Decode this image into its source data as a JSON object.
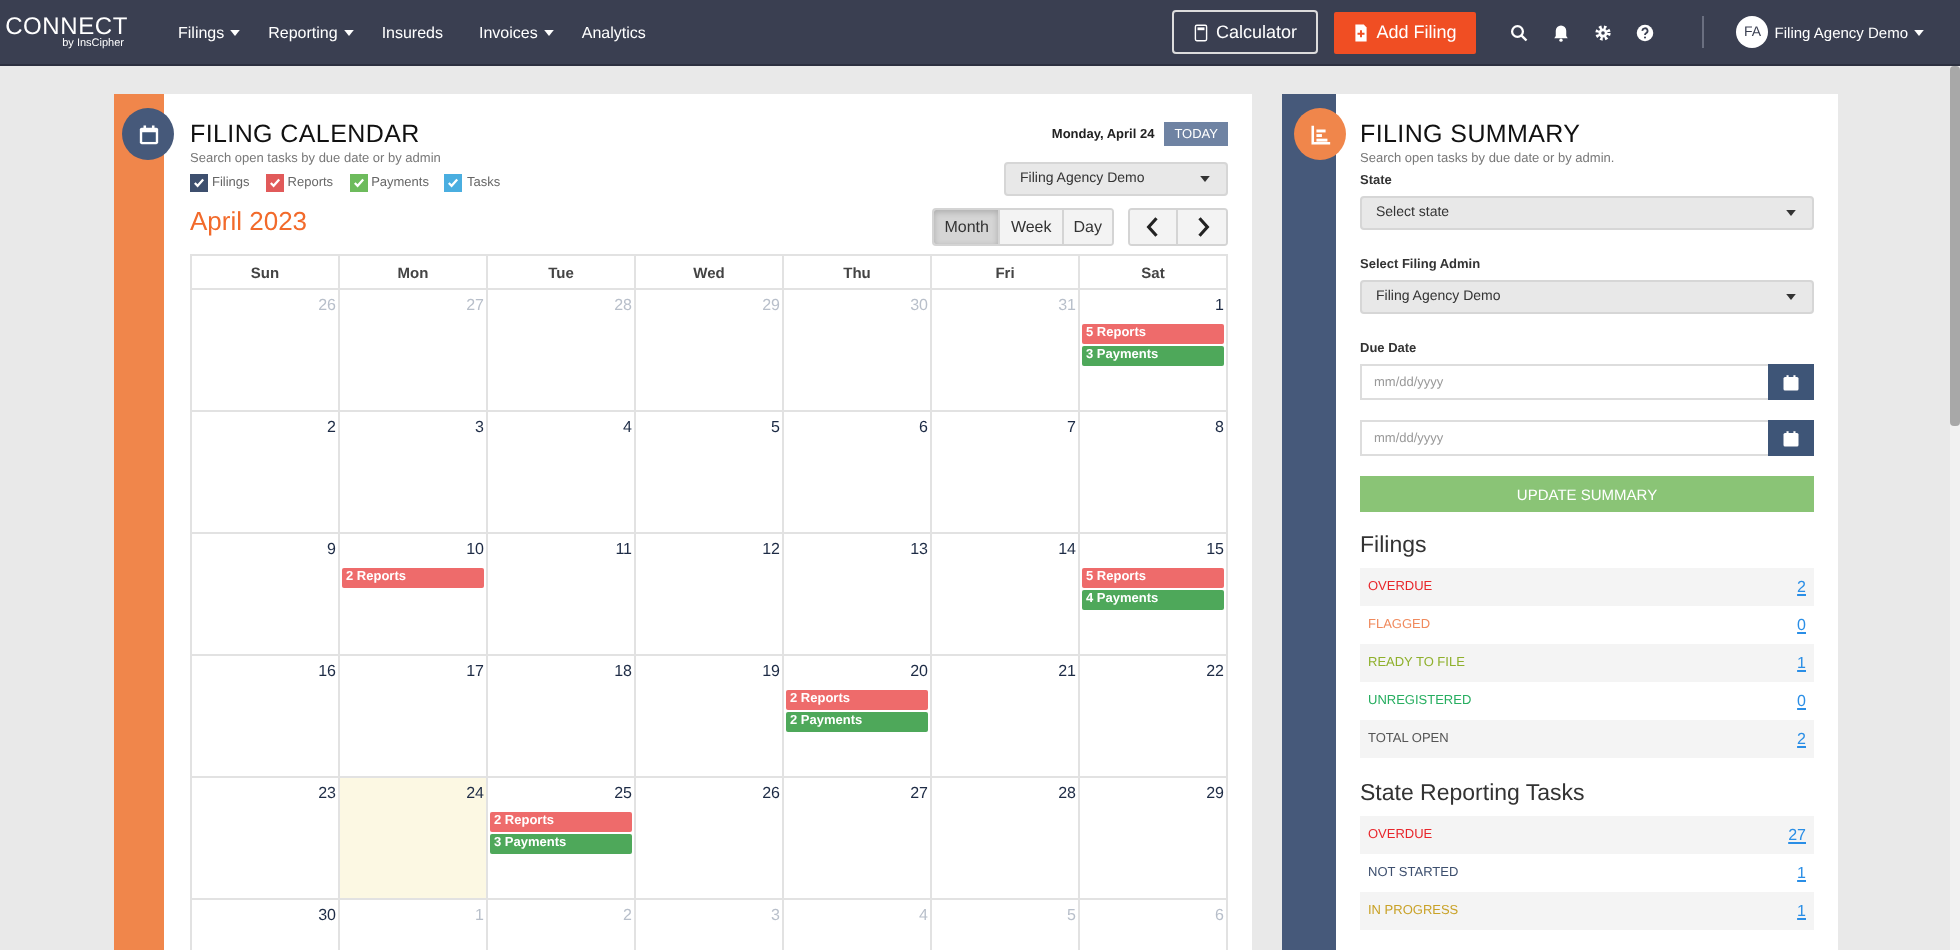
{
  "nav": {
    "logo": "CONNECT",
    "logo_sub": "by InsCipher",
    "menu": [
      {
        "label": "Filings",
        "dropdown": true
      },
      {
        "label": "Reporting",
        "dropdown": true
      },
      {
        "label": "Insureds",
        "dropdown": false
      },
      {
        "label": "Invoices",
        "dropdown": true
      },
      {
        "label": "Analytics",
        "dropdown": false
      }
    ],
    "calculator": "Calculator",
    "add_filing": "Add Filing",
    "user_initials": "FA",
    "user_name": "Filing Agency Demo"
  },
  "calendar": {
    "title": "FILING CALENDAR",
    "subtitle": "Search open tasks by due date or by admin",
    "current_date": "Monday, April 24",
    "today_button": "TODAY",
    "admin_select": "Filing Agency Demo",
    "filters": [
      {
        "label": "Filings",
        "checked": true,
        "color": "#3d4f6e"
      },
      {
        "label": "Reports",
        "checked": true,
        "color": "#e15a5a"
      },
      {
        "label": "Payments",
        "checked": true,
        "color": "#6dbb5c"
      },
      {
        "label": "Tasks",
        "checked": true,
        "color": "#4aaee0"
      }
    ],
    "month_title": "April 2023",
    "views": [
      {
        "label": "Month",
        "selected": true
      },
      {
        "label": "Week",
        "selected": false
      },
      {
        "label": "Day",
        "selected": false
      }
    ],
    "weekdays": [
      "Sun",
      "Mon",
      "Tue",
      "Wed",
      "Thu",
      "Fri",
      "Sat"
    ],
    "weeks": [
      [
        {
          "day": "26",
          "other_month": true,
          "today": false
        },
        {
          "day": "27",
          "other_month": true,
          "today": false
        },
        {
          "day": "28",
          "other_month": true,
          "today": false
        },
        {
          "day": "29",
          "other_month": true,
          "today": false
        },
        {
          "day": "30",
          "other_month": true,
          "today": false
        },
        {
          "day": "31",
          "other_month": true,
          "today": false
        },
        {
          "day": "1",
          "other_month": false,
          "today": false,
          "events": [
            {
              "label": "5 Reports",
              "kind": "report"
            },
            {
              "label": "3 Payments",
              "kind": "payment"
            }
          ]
        }
      ],
      [
        {
          "day": "2",
          "other_month": false,
          "today": false
        },
        {
          "day": "3",
          "other_month": false,
          "today": false
        },
        {
          "day": "4",
          "other_month": false,
          "today": false
        },
        {
          "day": "5",
          "other_month": false,
          "today": false
        },
        {
          "day": "6",
          "other_month": false,
          "today": false
        },
        {
          "day": "7",
          "other_month": false,
          "today": false
        },
        {
          "day": "8",
          "other_month": false,
          "today": false
        }
      ],
      [
        {
          "day": "9",
          "other_month": false,
          "today": false
        },
        {
          "day": "10",
          "other_month": false,
          "today": false,
          "events": [
            {
              "label": "2 Reports",
              "kind": "report"
            }
          ]
        },
        {
          "day": "11",
          "other_month": false,
          "today": false
        },
        {
          "day": "12",
          "other_month": false,
          "today": false
        },
        {
          "day": "13",
          "other_month": false,
          "today": false
        },
        {
          "day": "14",
          "other_month": false,
          "today": false
        },
        {
          "day": "15",
          "other_month": false,
          "today": false,
          "events": [
            {
              "label": "5 Reports",
              "kind": "report"
            },
            {
              "label": "4 Payments",
              "kind": "payment"
            }
          ]
        }
      ],
      [
        {
          "day": "16",
          "other_month": false,
          "today": false
        },
        {
          "day": "17",
          "other_month": false,
          "today": false
        },
        {
          "day": "18",
          "other_month": false,
          "today": false
        },
        {
          "day": "19",
          "other_month": false,
          "today": false
        },
        {
          "day": "20",
          "other_month": false,
          "today": false,
          "events": [
            {
              "label": "2 Reports",
              "kind": "report"
            },
            {
              "label": "2 Payments",
              "kind": "payment"
            }
          ]
        },
        {
          "day": "21",
          "other_month": false,
          "today": false
        },
        {
          "day": "22",
          "other_month": false,
          "today": false
        }
      ],
      [
        {
          "day": "23",
          "other_month": false,
          "today": false
        },
        {
          "day": "24",
          "other_month": false,
          "today": true
        },
        {
          "day": "25",
          "other_month": false,
          "today": false,
          "events": [
            {
              "label": "2 Reports",
              "kind": "report"
            },
            {
              "label": "3 Payments",
              "kind": "payment"
            }
          ]
        },
        {
          "day": "26",
          "other_month": false,
          "today": false
        },
        {
          "day": "27",
          "other_month": false,
          "today": false
        },
        {
          "day": "28",
          "other_month": false,
          "today": false
        },
        {
          "day": "29",
          "other_month": false,
          "today": false
        }
      ],
      [
        {
          "day": "30",
          "other_month": false,
          "today": false
        },
        {
          "day": "1",
          "other_month": true,
          "today": false
        },
        {
          "day": "2",
          "other_month": true,
          "today": false
        },
        {
          "day": "3",
          "other_month": true,
          "today": false
        },
        {
          "day": "4",
          "other_month": true,
          "today": false
        },
        {
          "day": "5",
          "other_month": true,
          "today": false
        },
        {
          "day": "6",
          "other_month": true,
          "today": false
        }
      ]
    ]
  },
  "summary": {
    "title": "FILING SUMMARY",
    "subtitle": "Search open tasks by due date or by admin.",
    "state_label": "State",
    "state_select": "Select state",
    "admin_label": "Select Filing Admin",
    "admin_select": "Filing Agency Demo",
    "due_label": "Due Date",
    "date_fields": [
      {
        "placeholder": "mm/dd/yyyy"
      },
      {
        "placeholder": "mm/dd/yyyy"
      }
    ],
    "update_button": "UPDATE SUMMARY",
    "sections": [
      {
        "heading": "Filings",
        "rows": [
          {
            "label": "OVERDUE",
            "count": "2",
            "color": "#e8262b"
          },
          {
            "label": "FLAGGED",
            "count": "0",
            "color": "#f08a5d"
          },
          {
            "label": "READY TO FILE",
            "count": "1",
            "color": "#8fb02c"
          },
          {
            "label": "UNREGISTERED",
            "count": "0",
            "color": "#27ae60"
          },
          {
            "label": "TOTAL OPEN",
            "count": "2",
            "color": "#555555"
          }
        ]
      },
      {
        "heading": "State Reporting Tasks",
        "rows": [
          {
            "label": "OVERDUE",
            "count": "27",
            "color": "#e8262b"
          },
          {
            "label": "NOT STARTED",
            "count": "1",
            "color": "#3d4f6e"
          },
          {
            "label": "IN PROGRESS",
            "count": "1",
            "color": "#c9a227"
          }
        ]
      }
    ]
  }
}
